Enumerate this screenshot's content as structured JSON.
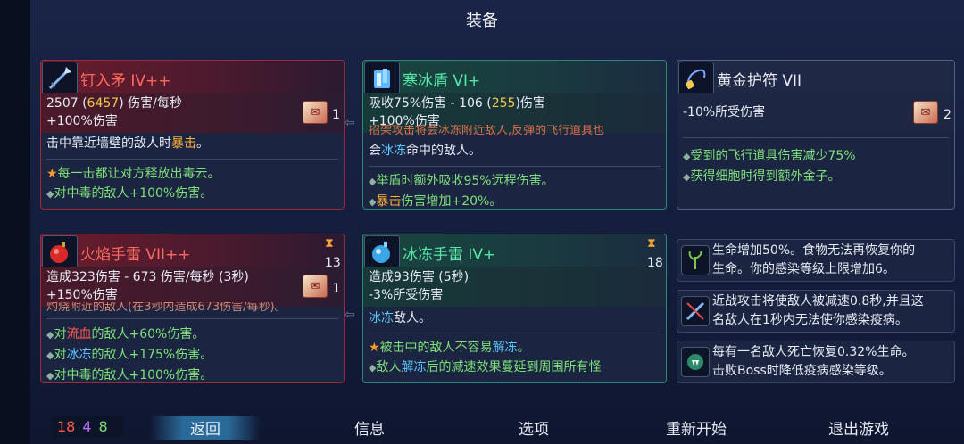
{
  "page": {
    "title": "装备"
  },
  "colors": {
    "legendary_red": "#ff6a5e",
    "epic_green": "#56e6a8",
    "stat_yellow": "#f2c94c",
    "freeze_cyan": "#5ec8ff",
    "crit_orange": "#ffb23a",
    "bleed_red": "#ff5a4a",
    "bullet_green": "#7ee07a"
  },
  "weapon1": {
    "icon": "spear-icon",
    "title": "钉入矛 IV++",
    "dps_base": "2507 (",
    "dps_max": "6457",
    "dps_tail": ") 伤害/每秒",
    "bonus": "+100%伤害",
    "scroll_count": "1",
    "desc_pre": "击中靠近墙壁的敌人时",
    "desc_hl": "暴击",
    "desc_post": "。",
    "b1_pre": "每一击都让对方释放出",
    "b1_hl": "毒云",
    "b1_post": "。",
    "b2_pre": "对",
    "b2_hl": "中毒",
    "b2_post": "的敌人+100%伤害。"
  },
  "weapon2": {
    "icon": "ice-shield-icon",
    "title": "寒冰盾 VI+",
    "stat_pre": "吸收75%伤害 - 106 (",
    "stat_hl": "255",
    "stat_post": ")伤害",
    "bonus": "+100%伤害",
    "desc_cut": "招架攻击将会冰冻附近敌人,反弹的飞行道具也",
    "desc2_pre": "会",
    "desc2_hl": "冰冻",
    "desc2_post": "命中的敌人。",
    "b1": "举盾时额外吸收95%远程伤害。",
    "b2_hl": "暴击",
    "b2_post": "伤害增加+20%。"
  },
  "amulet": {
    "icon": "amulet-icon",
    "title": "黄金护符 VII",
    "stat": "-10%所受伤害",
    "scroll_count": "2",
    "b1": "受到的飞行道具伤害减少75%",
    "b2": "获得细胞时得到额外金子。"
  },
  "skill1": {
    "icon": "bomb-icon",
    "title": "火焰手雷 VII++",
    "cooldown": "13",
    "stat": "造成323伤害 - 673 伤害/每秒 (3秒)",
    "bonus": "+150%伤害",
    "scroll_count": "1",
    "desc_cut": "灼烧附近的敌人(在3秒内造成673伤害/每秒)。",
    "b1_pre": "对",
    "b1_hl": "流血",
    "b1_post": "的敌人+60%伤害。",
    "b2_pre": "对",
    "b2_hl": "冰冻",
    "b2_post": "的敌人+175%伤害。",
    "b3_pre": "对",
    "b3_hl": "中毒",
    "b3_post": "的敌人+100%伤害。"
  },
  "skill2": {
    "icon": "ice-grenade-icon",
    "title": "冰冻手雷 IV+",
    "cooldown": "18",
    "stat": "造成93伤害 (5秒)",
    "bonus": "-3%所受伤害",
    "desc_hl": "冰冻",
    "desc_post": "敌人。",
    "b1_pre": "被击中的敌人不容易",
    "b1_hl": "解冻",
    "b1_post": "。",
    "b2_pre": "敌人",
    "b2_hl": "解冻",
    "b2_post": "后的减速效果蔓延到周围所有怪"
  },
  "mutations": [
    {
      "icon": "plant-icon",
      "line1": "生命增加50%。食物无法再恢复你的",
      "line2": "生命。你的感染等级上限增加6。"
    },
    {
      "icon": "frost-blade-icon",
      "line1": "近战攻击将使敌人被减速0.8秒,并且这",
      "line2": "名敌人在1秒内无法使你感染疫病。"
    },
    {
      "icon": "vampire-icon",
      "line1": "每有一名敌人死亡恢复0.32%生命。",
      "line2": "击败Boss时降低疫病感染等级。"
    }
  ],
  "bottom": {
    "scrolls_red": "18",
    "scrolls_purple": "4",
    "scrolls_green": "8",
    "back": "返回",
    "info": "信息",
    "options": "选项",
    "restart": "重新开始",
    "quit": "退出游戏"
  }
}
